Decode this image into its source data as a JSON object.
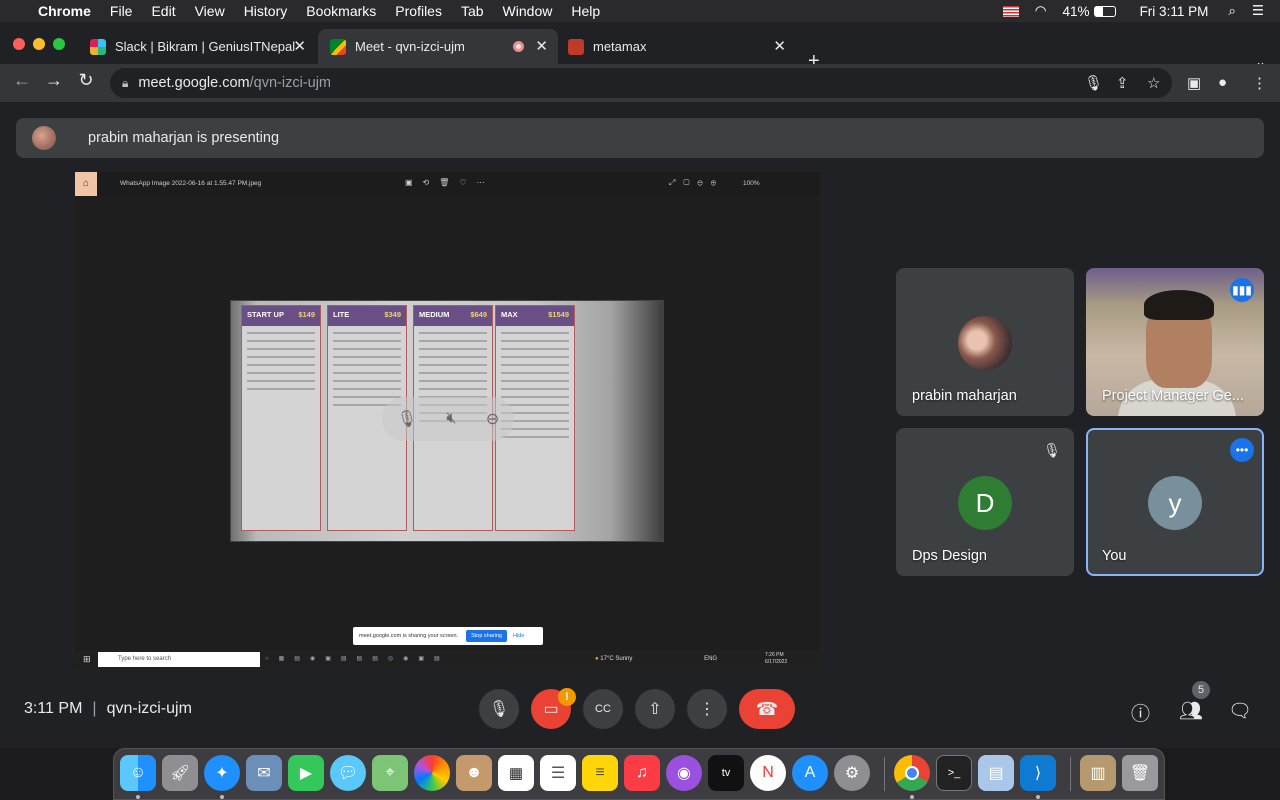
{
  "menubar": {
    "app": "Chrome",
    "items": [
      "File",
      "Edit",
      "View",
      "History",
      "Bookmarks",
      "Profiles",
      "Tab",
      "Window",
      "Help"
    ],
    "battery": "41%",
    "datetime": "Fri 3:11 PM"
  },
  "tabs": [
    {
      "title": "Slack | Bikram | GeniusITNepal",
      "favicon_color": "#e01e5a"
    },
    {
      "title": "Meet - qvn-izci-ujm",
      "favicon_color": "#00ac47"
    },
    {
      "title": "metamax",
      "favicon_color": "#c0392b"
    }
  ],
  "omnibox": {
    "host": "meet.google.com",
    "path": "/qvn-izci-ujm"
  },
  "banner": {
    "text": "prabin maharjan is presenting"
  },
  "presentation": {
    "window_title": "WhatsApp Image 2022-06-16 at 1.55.47 PM.jpeg",
    "zoom": "100%",
    "plans": [
      {
        "name": "START UP",
        "price": "$149"
      },
      {
        "name": "LITE",
        "price": "$349"
      },
      {
        "name": "MEDIUM",
        "price": "$649"
      },
      {
        "name": "MAX",
        "price": "$1549"
      }
    ],
    "share_notice": "meet.google.com is sharing your screen.",
    "share_stop": "Stop sharing",
    "share_hide": "Hide",
    "taskbar_search": "Type here to search",
    "weather": "17°C Sunny",
    "lang": "ENG",
    "win_time": "7:26 PM",
    "win_date": "6/17/2022"
  },
  "participants": [
    {
      "name": "prabin maharjan",
      "type": "photo"
    },
    {
      "name": "Project Manager Ge...",
      "type": "video"
    },
    {
      "name": "Dps Design",
      "initial": "D",
      "avatar_color": "#2e7d32",
      "muted": true
    },
    {
      "name": "You",
      "initial": "y",
      "avatar_color": "#78909c"
    }
  ],
  "meeting": {
    "time": "3:11 PM",
    "code": "qvn-izci-ujm",
    "participant_count": "5",
    "cam_warning": "!"
  },
  "colors": {
    "accent": "#8ab4f8",
    "end_call": "#ea4335",
    "warning": "#f29900"
  }
}
